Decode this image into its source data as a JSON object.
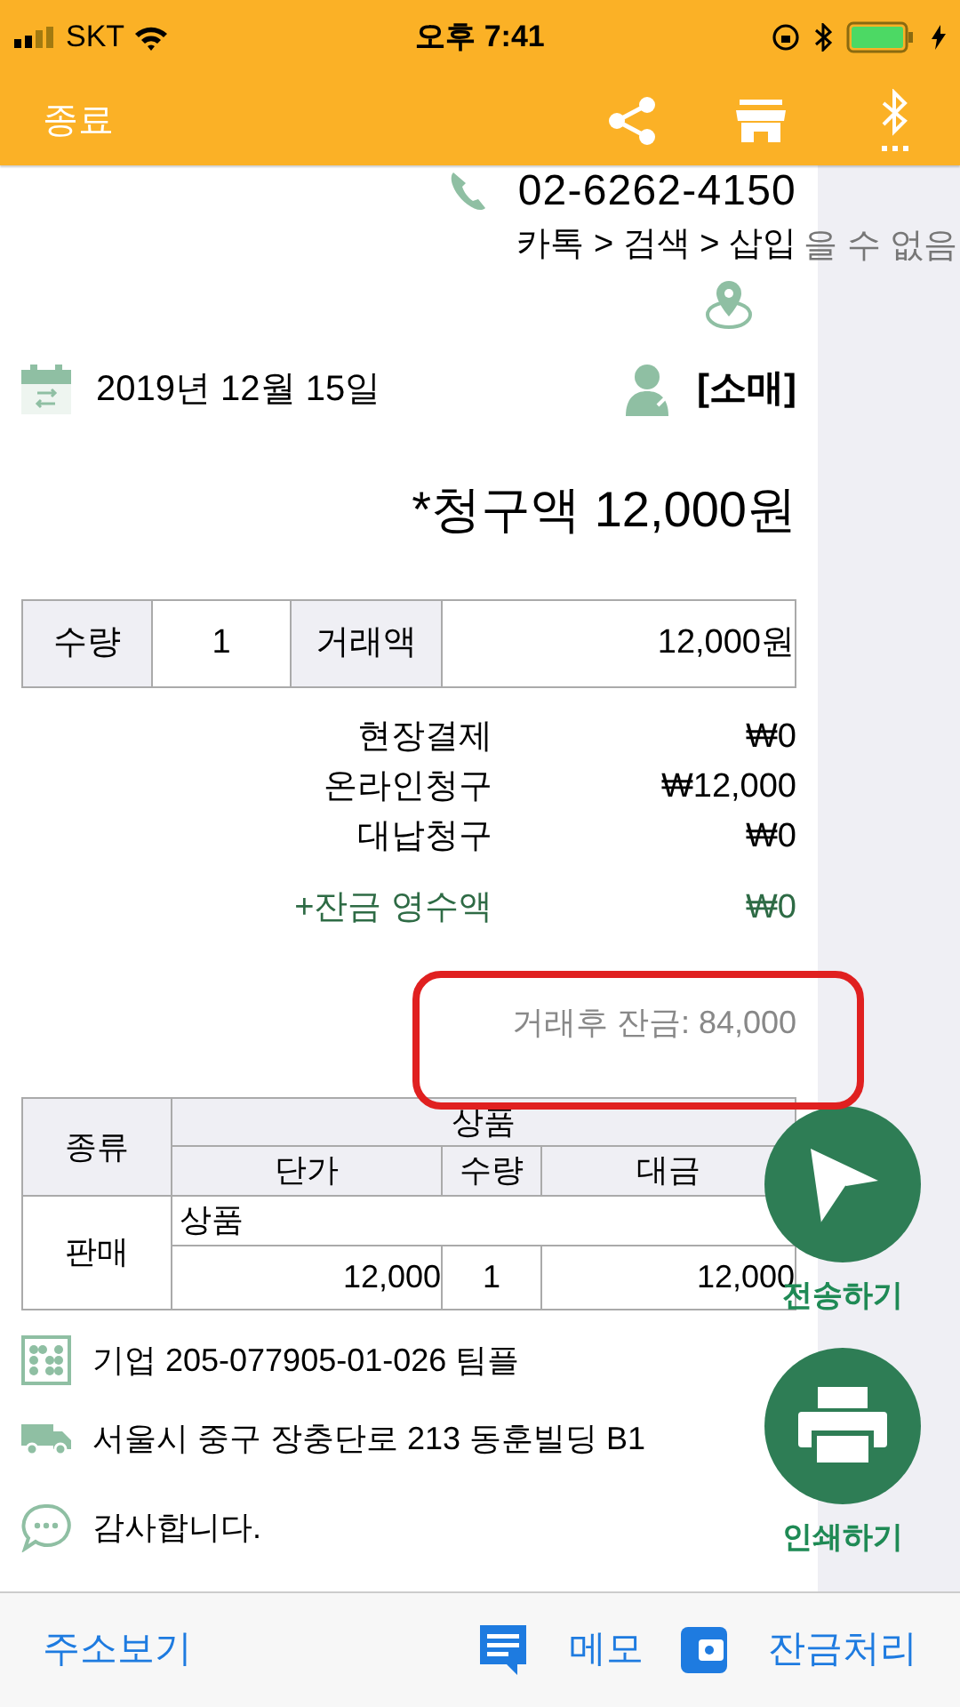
{
  "status_bar": {
    "carrier": "SKT",
    "time": "오후 7:41"
  },
  "header": {
    "close_label": "종료"
  },
  "contact": {
    "phone": "02-6262-4150",
    "breadcrumb": "카톡 > 검색 > 삽입",
    "notice": "을 수 없음"
  },
  "date": "2019년 12월 15일",
  "customer_type": "[소매]",
  "total": "*청구액 12,000원",
  "summary": {
    "qty_label": "수량",
    "qty": "1",
    "amount_label": "거래액",
    "amount": "12,000원"
  },
  "payments": [
    {
      "label": "현장결제",
      "value": "₩0",
      "kind": "normal"
    },
    {
      "label": "온라인청구",
      "value": "₩12,000",
      "kind": "normal"
    },
    {
      "label": "대납청구",
      "value": "₩0",
      "kind": "normal"
    },
    {
      "label": "+잔금 영수액",
      "value": "₩0",
      "kind": "link"
    }
  ],
  "balance_after": "거래후 잔금: 84,000",
  "items_table": {
    "type_header": "종류",
    "product_header": "상품",
    "columns": [
      "단가",
      "수량",
      "대금"
    ],
    "rows": [
      {
        "type": "판매",
        "product": "상품",
        "unit_price": "12,000",
        "qty": "1",
        "total": "12,000"
      }
    ]
  },
  "info": [
    {
      "kind": "bank",
      "text": "기업 205-077905-01-026 팀플"
    },
    {
      "kind": "address",
      "text": "서울시 중구 장충단로 213 동훈빌딩 B1"
    },
    {
      "kind": "message",
      "text": "감사합니다."
    }
  ],
  "actions": [
    {
      "kind": "send",
      "label": "전송하기"
    },
    {
      "kind": "print",
      "label": "인쇄하기"
    }
  ],
  "bottom_bar": [
    {
      "kind": "plain",
      "label": "주소보기"
    },
    {
      "kind": "memo",
      "label": "메모"
    },
    {
      "kind": "balance",
      "label": "잔금처리"
    }
  ]
}
